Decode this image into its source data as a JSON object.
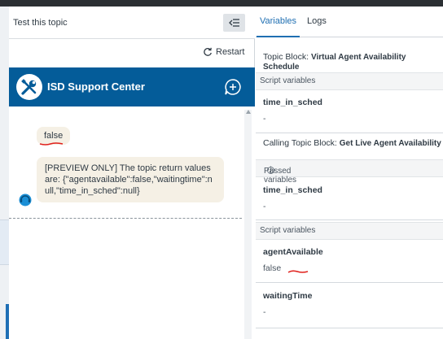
{
  "left_panel": {
    "title": "Test this topic",
    "restart_label": "Restart",
    "chat": {
      "name": "ISD Support Center",
      "messages": [
        {
          "text": "false"
        },
        {
          "text": "[PREVIEW ONLY] The topic return values are: {\"agentavailable\":false,\"waitingtime\":null,\"time_in_sched\":null}"
        }
      ]
    }
  },
  "right_panel": {
    "tabs": [
      {
        "label": "Variables",
        "active": true
      },
      {
        "label": "Logs",
        "active": false
      }
    ],
    "topic_block": {
      "label": "Topic Block:",
      "value": "Virtual Agent Availability Schedule"
    },
    "script_vars_1": {
      "header": "Script variables",
      "items": [
        {
          "name": "time_in_sched",
          "value": "-"
        }
      ]
    },
    "calling_topic": {
      "label": "Calling Topic Block:",
      "value": "Get Live Agent Availability"
    },
    "passed_vars": {
      "header": "Passed variables",
      "items": [
        {
          "name": "time_in_sched",
          "value": "-"
        }
      ]
    },
    "script_vars_2": {
      "header": "Script variables",
      "items": [
        {
          "name": "agentAvailable",
          "value": "false"
        },
        {
          "name": "waitingTime",
          "value": "-"
        }
      ]
    }
  },
  "colors": {
    "accent": "#1f6fb2",
    "chat_header": "#045c99",
    "bubble": "#f5f0e5",
    "annotation": "#e0201b"
  },
  "icons": [
    "collapse-panel-icon",
    "restart-icon",
    "wrench-screwdriver-icon",
    "new-chat-icon",
    "bot-avatar-icon",
    "info-icon"
  ]
}
